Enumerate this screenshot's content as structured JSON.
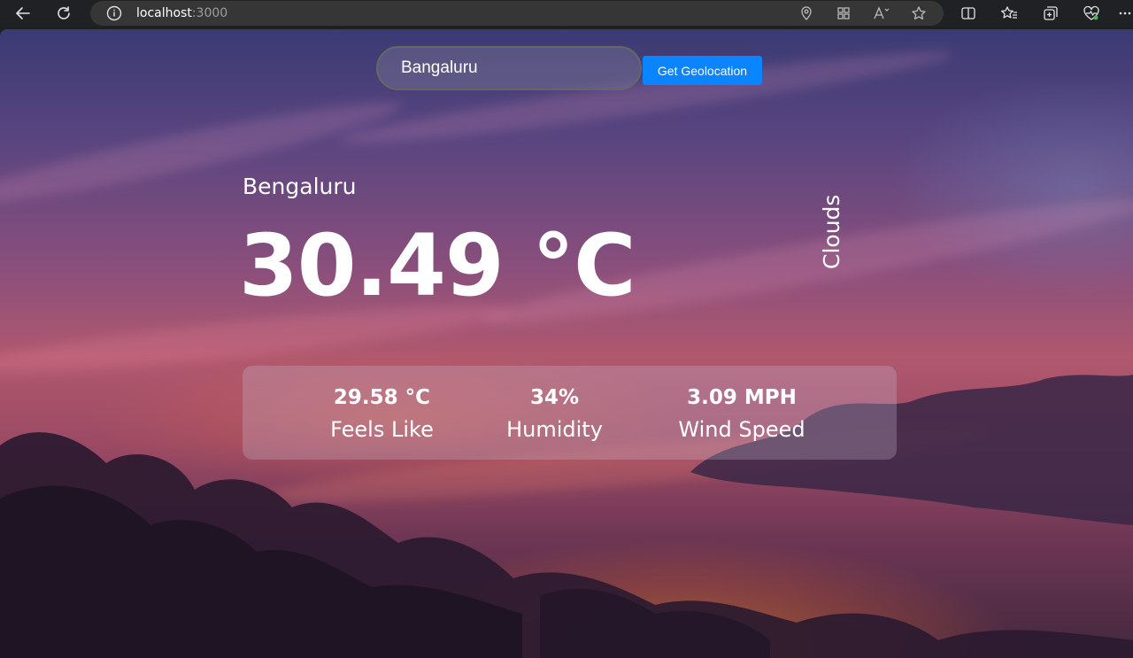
{
  "browser": {
    "url_host": "localhost",
    "url_port": ":3000",
    "icons": [
      "back-icon",
      "reload-icon",
      "info-icon",
      "location-icon",
      "apps-icon",
      "read-aloud-icon",
      "favorite-star-icon",
      "split-screen-icon",
      "favorites-icon",
      "collections-icon",
      "health-icon",
      "more-icon"
    ]
  },
  "search": {
    "value": "Bangaluru",
    "button_label": "Get Geolocation",
    "button_color": "#0a84ff"
  },
  "weather": {
    "city": "Bengaluru",
    "temperature": "30.49 °C",
    "description": "Clouds",
    "stats": [
      {
        "value": "29.58 °C",
        "label": "Feels Like"
      },
      {
        "value": "34%",
        "label": "Humidity"
      },
      {
        "value": "3.09 MPH",
        "label": "Wind Speed"
      }
    ]
  }
}
